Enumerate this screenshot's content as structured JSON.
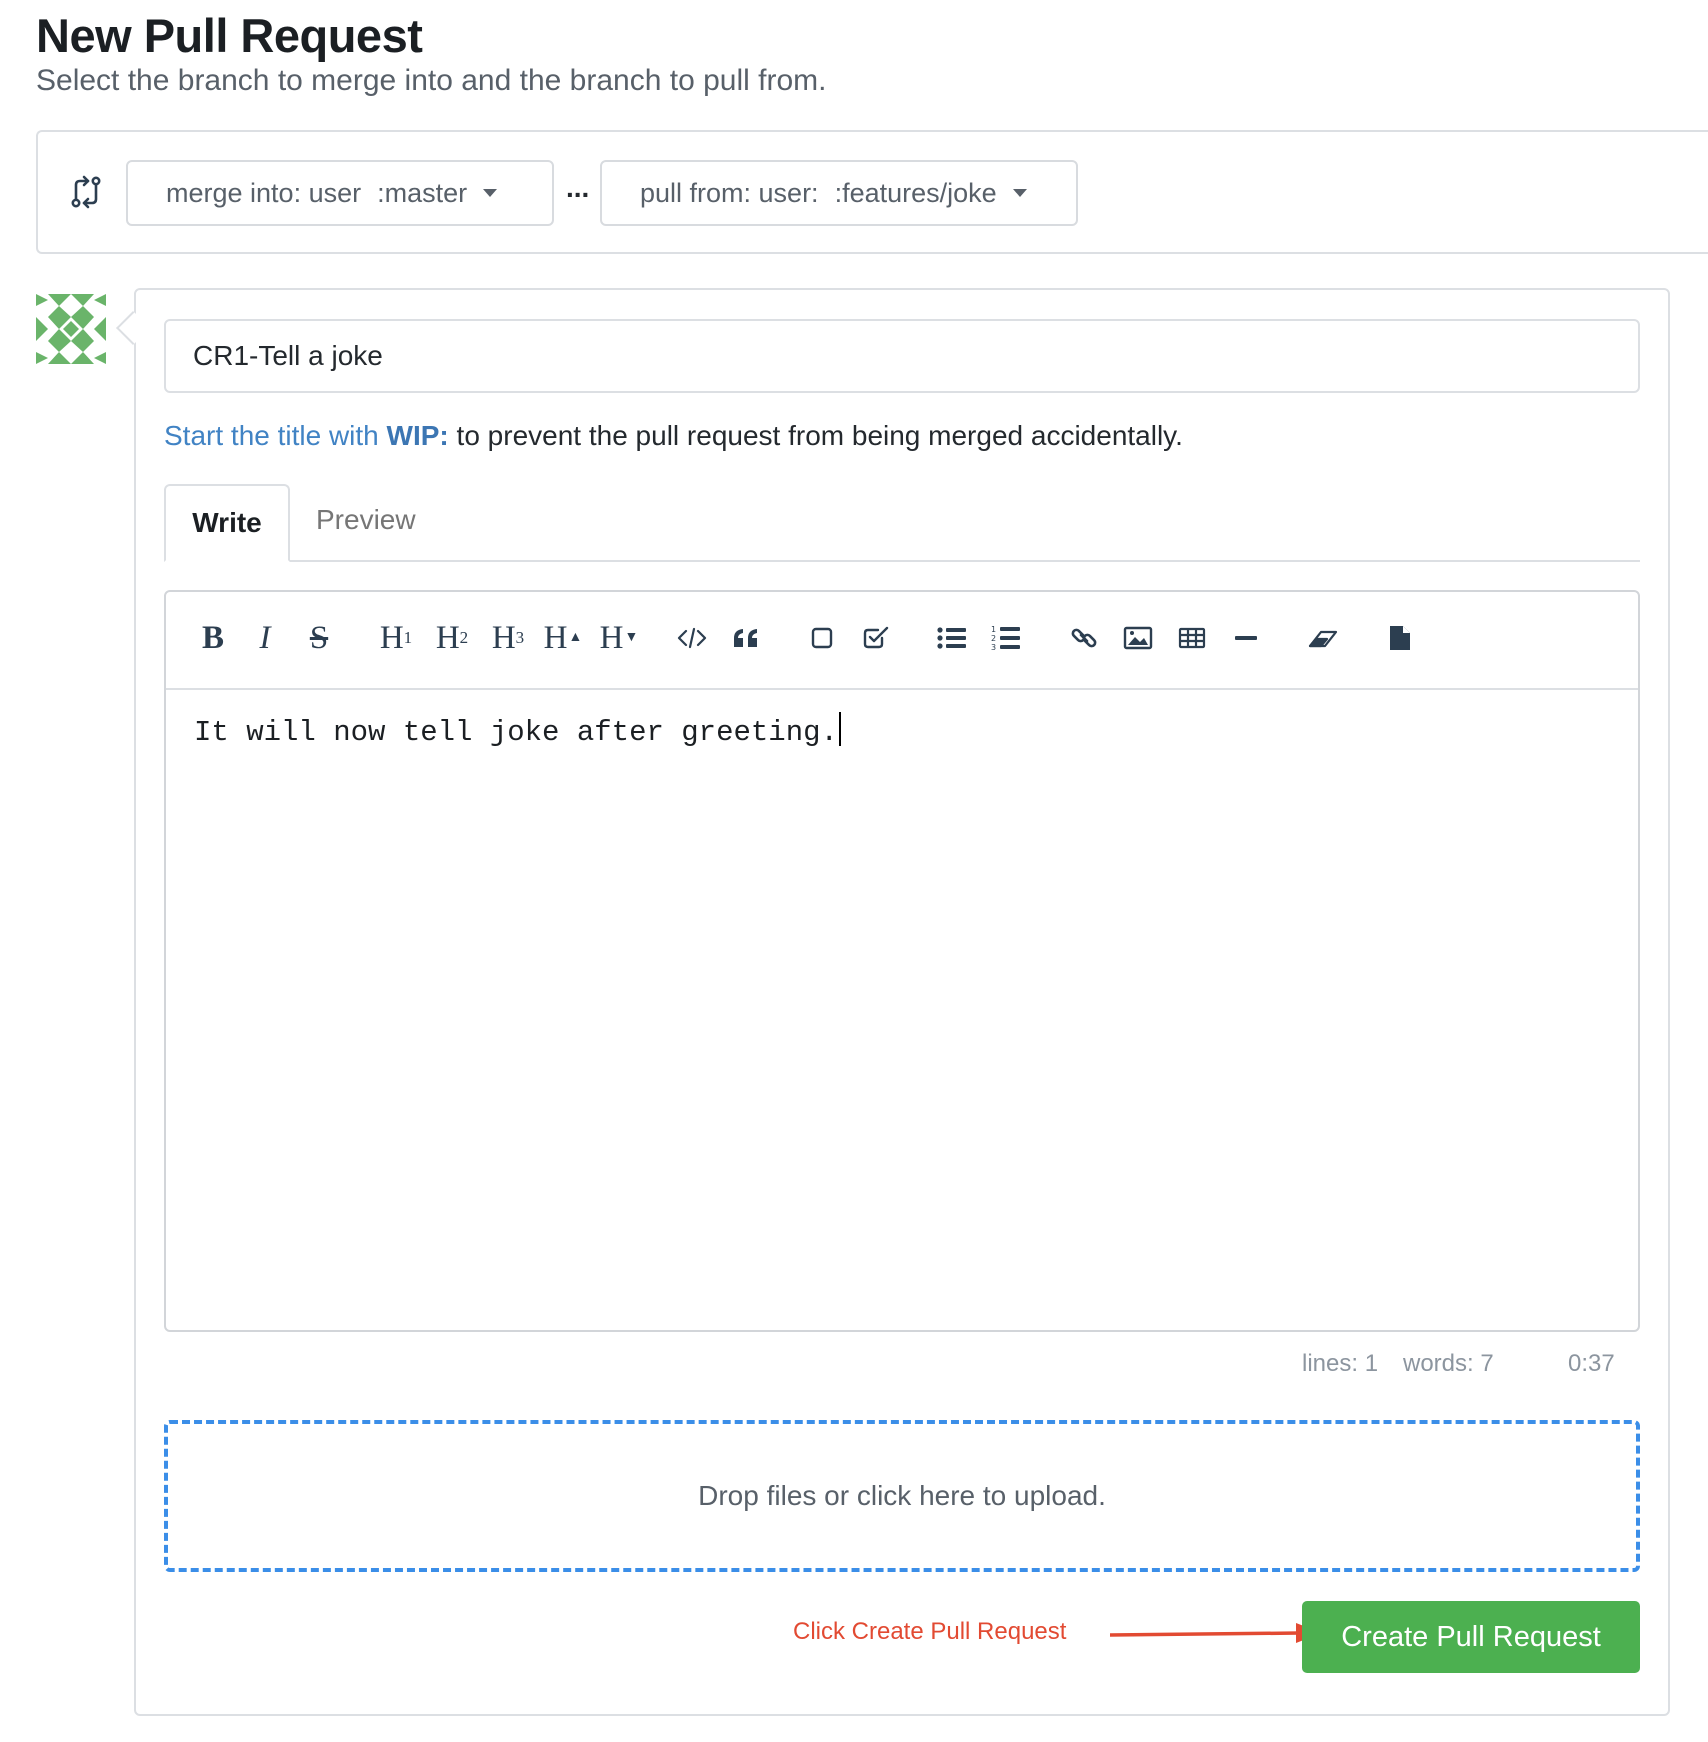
{
  "header": {
    "title": "New Pull Request",
    "subtitle": "Select the branch to merge into and the branch to pull from."
  },
  "branches": {
    "icon": "compare-arrows-icon",
    "merge_label": "merge into: user",
    "merge_branch": ":master",
    "separator": "...",
    "pull_label": "pull from: user:",
    "pull_branch": ":features/joke"
  },
  "avatar": {
    "icon": "identicon-avatar",
    "color": "#6ab46a"
  },
  "form": {
    "title_value": "CR1-Tell a joke",
    "wip_prefix": "Start the title with",
    "wip_keyword": "WIP:",
    "wip_suffix": "to prevent the pull request from being merged accidentally.",
    "tabs": [
      {
        "label": "Write",
        "active": true
      },
      {
        "label": "Preview",
        "active": false
      }
    ]
  },
  "toolbar": {
    "buttons": [
      {
        "name": "bold-icon",
        "glyph": "B"
      },
      {
        "name": "italic-icon",
        "glyph": "I"
      },
      {
        "name": "strikethrough-icon",
        "glyph": "S"
      },
      {
        "name": "heading-1-icon",
        "glyph": "H",
        "sub": "1"
      },
      {
        "name": "heading-2-icon",
        "glyph": "H",
        "sub": "2"
      },
      {
        "name": "heading-3-icon",
        "glyph": "H",
        "sub": "3"
      },
      {
        "name": "heading-bigger-icon",
        "glyph": "H",
        "sub": "▲"
      },
      {
        "name": "heading-smaller-icon",
        "glyph": "H",
        "sub": "▼"
      },
      {
        "name": "code-icon"
      },
      {
        "name": "quote-icon"
      },
      {
        "name": "checkbox-empty-icon"
      },
      {
        "name": "checkbox-checked-icon"
      },
      {
        "name": "unordered-list-icon"
      },
      {
        "name": "ordered-list-icon"
      },
      {
        "name": "link-icon"
      },
      {
        "name": "image-icon"
      },
      {
        "name": "table-icon"
      },
      {
        "name": "horizontal-rule-icon"
      },
      {
        "name": "eraser-icon"
      },
      {
        "name": "file-icon"
      }
    ]
  },
  "editor": {
    "content": "It will now tell joke after greeting.",
    "status": {
      "lines": "lines: 1",
      "words": "words: 7",
      "time": "0:37"
    }
  },
  "dropzone": {
    "text": "Drop files or click here to upload.",
    "border_color": "#3b8ee8"
  },
  "annotation": {
    "text": "Click Create Pull Request",
    "color": "#e24a32"
  },
  "submit": {
    "label": "Create Pull Request",
    "color": "#4cb050"
  }
}
